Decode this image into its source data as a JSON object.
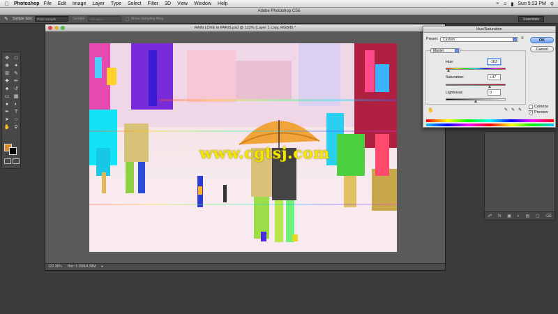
{
  "menubar": {
    "app_name": "Photoshop",
    "items": [
      "File",
      "Edit",
      "Image",
      "Layer",
      "Type",
      "Select",
      "Filter",
      "3D",
      "View",
      "Window",
      "Help"
    ],
    "clock": "Sun 5:23 PM"
  },
  "app_title": "Adobe Photoshop CS6",
  "options_bar": {
    "sample_size_label": "Sample Size:",
    "sample_size_value": "Point Sample",
    "sample_label": "Sample:",
    "sample_value": "All Layers",
    "show_ring_label": "Show Sampling Ring",
    "workspace": "Essentials"
  },
  "document": {
    "title": "RAIN LOVE in PARIS.psd @ 122% (Layer 1 copy, RGB/8) *",
    "zoom": "122.36%",
    "doc_info": "Doc: 1.35M/4.58M",
    "watermark": "www.cgtsj.com"
  },
  "colors": {
    "foreground": "#d98c2e",
    "background": "#000000"
  },
  "dialog": {
    "title": "Hue/Saturation",
    "preset_label": "Preset:",
    "preset_value": "Custom",
    "channel_value": "Master",
    "hue_label": "Hue:",
    "hue_value": "-163",
    "hue_fraction": 0.047,
    "saturation_label": "Saturation:",
    "saturation_value": "+47",
    "saturation_fraction": 0.735,
    "lightness_label": "Lightness:",
    "lightness_value": "0",
    "lightness_fraction": 0.5,
    "ok_label": "OK",
    "cancel_label": "Cancel",
    "colorize_label": "Colorize",
    "colorize_checked": false,
    "preview_label": "Preview",
    "preview_checked": true
  }
}
